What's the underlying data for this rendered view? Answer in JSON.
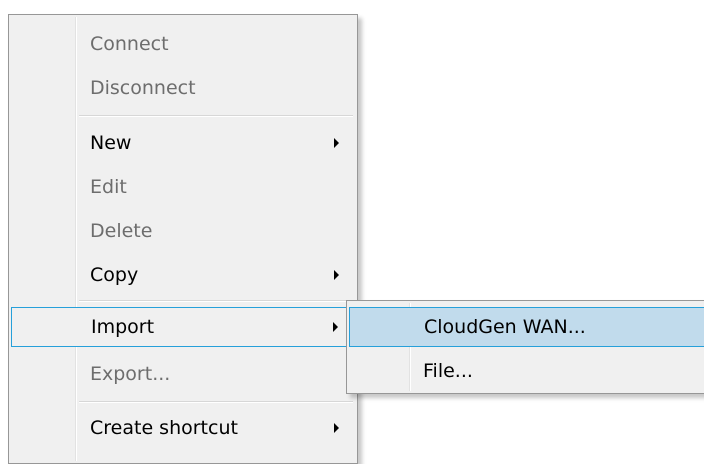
{
  "context_menu": {
    "items": [
      {
        "label": "Connect",
        "enabled": false
      },
      {
        "label": "Disconnect",
        "enabled": false
      },
      {
        "label": "New",
        "enabled": true,
        "submenu": true
      },
      {
        "label": "Edit",
        "enabled": false
      },
      {
        "label": "Delete",
        "enabled": false
      },
      {
        "label": "Copy",
        "enabled": true,
        "submenu": true
      },
      {
        "label": "Import",
        "enabled": true,
        "submenu": true,
        "highlighted": true
      },
      {
        "label": "Export...",
        "enabled": false
      },
      {
        "label": "Create shortcut",
        "enabled": true,
        "submenu": true
      }
    ]
  },
  "import_submenu": {
    "items": [
      {
        "label": "CloudGen WAN...",
        "enabled": true,
        "highlighted": true
      },
      {
        "label": "File...",
        "enabled": true
      }
    ]
  },
  "colors": {
    "menu_background": "#f0f0f0",
    "highlight_border": "#26a0da",
    "highlight_fill": "#c1dbec",
    "disabled_text": "#6d6d6d"
  }
}
